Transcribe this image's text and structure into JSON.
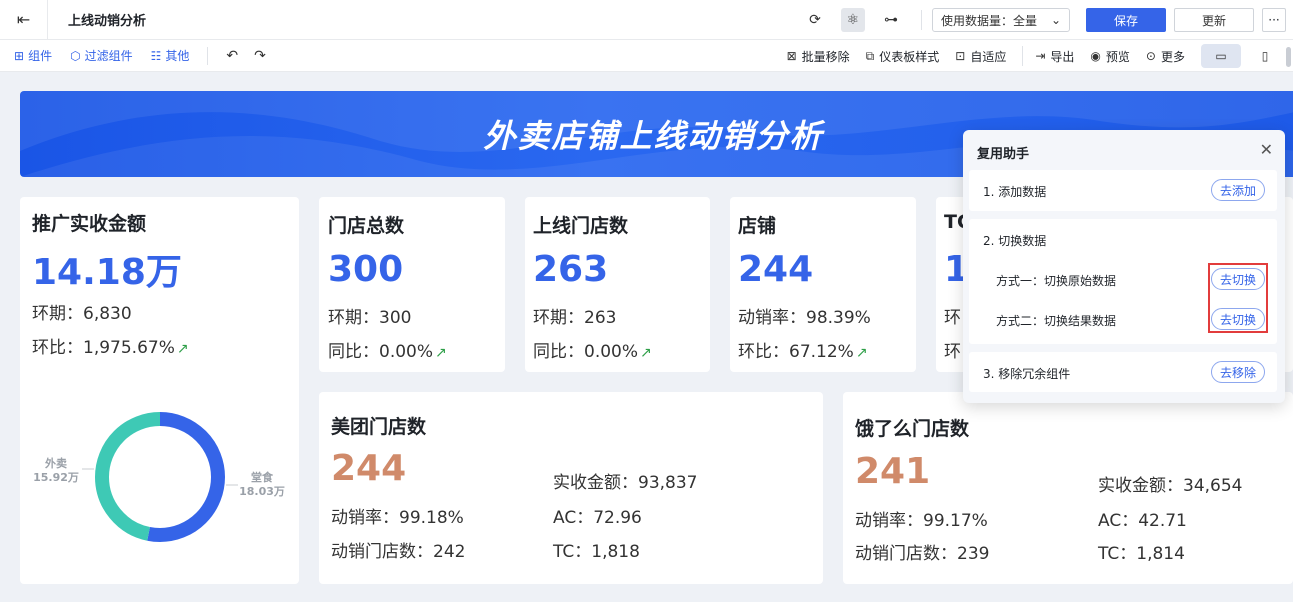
{
  "header": {
    "title": "上线动销分析",
    "data_usage_label": "使用数据量：全量",
    "save_label": "保存",
    "update_label": "更新",
    "more_label": "···"
  },
  "toolbar": {
    "component_label": "组件",
    "filter_label": "过滤组件",
    "other_label": "其他",
    "batch_remove_label": "批量移除",
    "dashboard_style_label": "仪表板样式",
    "adaptive_label": "自适应",
    "export_label": "导出",
    "preview_label": "预览",
    "more_label": "更多"
  },
  "banner": {
    "title": "外卖店铺上线动销分析"
  },
  "cards": {
    "promo": {
      "title": "推广实收金额",
      "value": "14.18万",
      "period": "环期：6,830",
      "ratio": "环比：1,975.67%",
      "donut": {
        "left_name": "外卖",
        "left_value": "15.92万",
        "right_name": "堂食",
        "right_value": "18.03万"
      }
    },
    "total_stores": {
      "title": "门店总数",
      "value": "300",
      "period": "环期：300",
      "yoy": "同比：0.00%"
    },
    "online_stores": {
      "title": "上线门店数",
      "value": "263",
      "period": "环期：263",
      "yoy": "同比：0.00%"
    },
    "shops": {
      "title": "店铺",
      "value": "244",
      "rate": "动销率：98.39%",
      "ratio": "环比：67.12%"
    },
    "tc_partial": {
      "title": "TC",
      "value": "1",
      "line1": "环",
      "line2": "环"
    },
    "meituan": {
      "title": "美团门店数",
      "value": "244",
      "rate": "动销率：99.18%",
      "active": "动销门店数：242",
      "amount": "实收金额：93,837",
      "ac": "AC：72.96",
      "tc": "TC：1,818"
    },
    "eleme": {
      "title": "饿了么门店数",
      "value": "241",
      "rate": "动销率：99.17%",
      "active": "动销门店数：239",
      "amount": "实收金额：34,654",
      "ac": "AC：42.71",
      "tc": "TC：1,814"
    }
  },
  "reuse_panel": {
    "title": "复用助手",
    "step1": "1. 添加数据",
    "step1_btn": "去添加",
    "step2": "2. 切换数据",
    "way1": "方式一：切换原始数据",
    "way1_btn": "去切换",
    "way2": "方式二：切换结果数据",
    "way2_btn": "去切换",
    "step3": "3. 移除冗余组件",
    "step3_btn": "去移除"
  },
  "chart_data": {
    "type": "pie",
    "categories": [
      "外卖",
      "堂食"
    ],
    "values": [
      15.92,
      18.03
    ],
    "unit": "万"
  },
  "colors": {
    "accent": "#3564e8",
    "orange": "#d08a6a",
    "teal": "#3ec9b5",
    "up": "#2e9f48",
    "highlight": "#e23c3c"
  }
}
